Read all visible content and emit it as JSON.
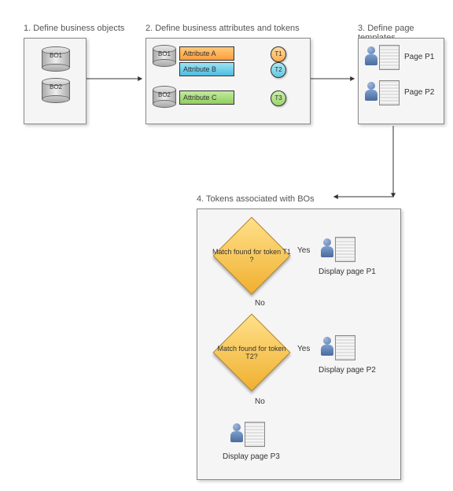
{
  "titles": {
    "step1": "1. Define business objects",
    "step2": "2. Define business attributes and tokens",
    "step3": "3. Define page templates",
    "step4": "4. Tokens associated with BOs"
  },
  "bo": {
    "bo1": "BO1",
    "bo2": "BO2"
  },
  "attr": {
    "a": "Attribute A",
    "b": "Attribute B",
    "c": "Attribute C"
  },
  "tok": {
    "t1": "T1",
    "t2": "T2",
    "t3": "T3"
  },
  "page": {
    "p1": "Page P1",
    "p2": "Page P2"
  },
  "flow": {
    "q1": "Match found for token T1 ?",
    "q2": "Match found for token T2?",
    "yes": "Yes",
    "no": "No",
    "dp1": "Display page P1",
    "dp2": "Display page P2",
    "dp3": "Display page P3"
  }
}
